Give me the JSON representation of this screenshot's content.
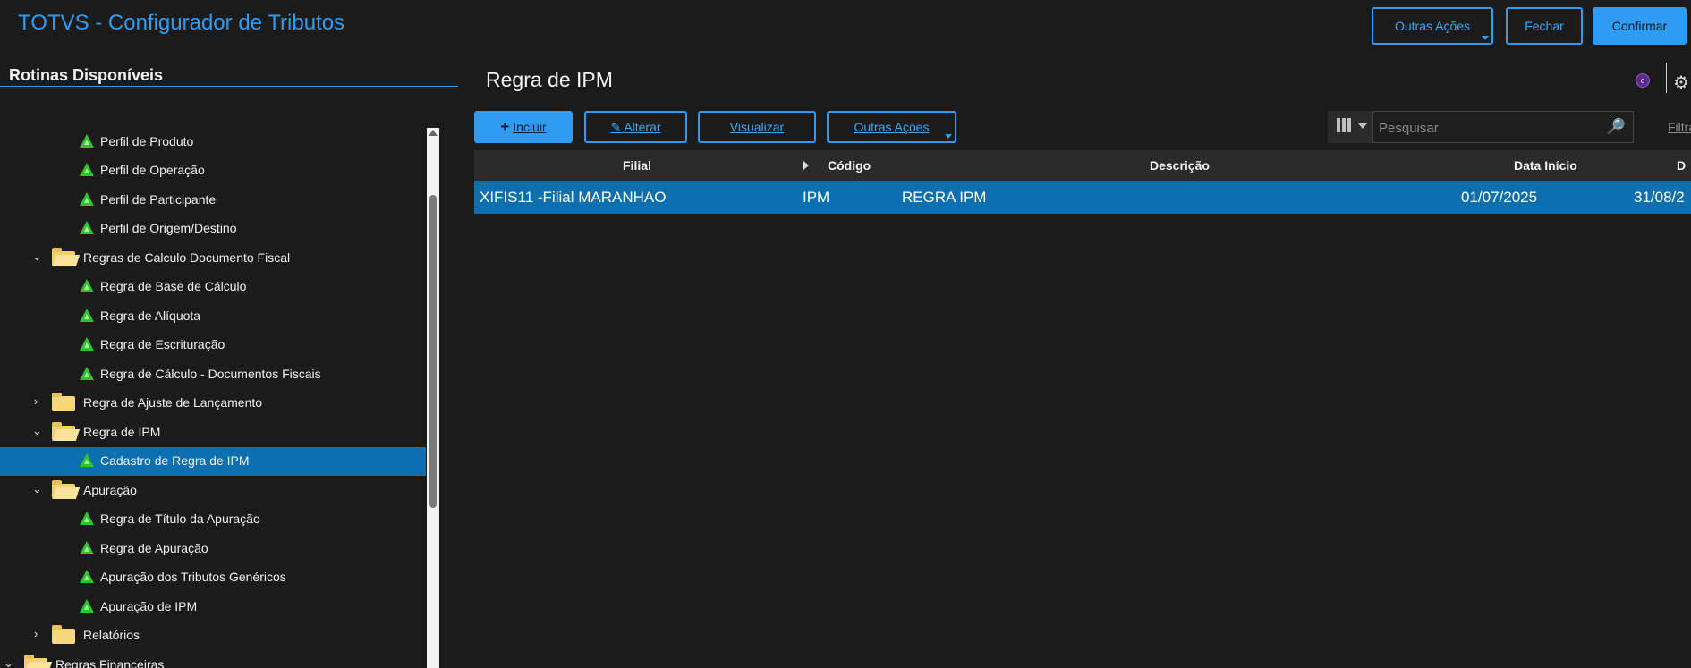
{
  "header": {
    "app_title": "TOTVS - Configurador de Tributos",
    "buttons": {
      "outras_acoes": "Outras Ações",
      "fechar": "Fechar",
      "confirmar": "Confirmar"
    }
  },
  "left_panel": {
    "title": "Rotinas Disponíveis",
    "tree": [
      {
        "label": "Perfil de Produto",
        "type": "leaf"
      },
      {
        "label": "Perfil de Operação",
        "type": "leaf"
      },
      {
        "label": "Perfil de Participante",
        "type": "leaf"
      },
      {
        "label": "Perfil de Origem/Destino",
        "type": "leaf"
      },
      {
        "label": "Regras de Calculo Documento Fiscal",
        "type": "folder-open"
      },
      {
        "label": "Regra de Base de Cálculo",
        "type": "leaf"
      },
      {
        "label": "Regra de Alíquota",
        "type": "leaf"
      },
      {
        "label": "Regra de Escrituração",
        "type": "leaf"
      },
      {
        "label": "Regra de Cálculo - Documentos Fiscais",
        "type": "leaf"
      },
      {
        "label": "Regra de Ajuste de Lançamento",
        "type": "folder-closed"
      },
      {
        "label": "Regra de IPM",
        "type": "folder-open"
      },
      {
        "label": "Cadastro de Regra de IPM",
        "type": "leaf",
        "selected": true
      },
      {
        "label": "Apuração",
        "type": "folder-open"
      },
      {
        "label": "Regra de Título da Apuração",
        "type": "leaf"
      },
      {
        "label": "Regra de Apuração",
        "type": "leaf"
      },
      {
        "label": "Apuração dos Tributos Genéricos",
        "type": "leaf"
      },
      {
        "label": "Apuração de IPM",
        "type": "leaf"
      },
      {
        "label": "Relatórios",
        "type": "folder-closed"
      },
      {
        "label": "Regras Financeiras",
        "type": "folder-open"
      }
    ]
  },
  "main": {
    "title": "Regra de IPM",
    "toolbar": {
      "incluir": "Incluir",
      "alterar": "Alterar",
      "visualizar": "Visualizar",
      "outras_acoes": "Outras Ações",
      "search_placeholder": "Pesquisar",
      "filter_link": "Filtrar"
    },
    "grid": {
      "columns": [
        "Filial",
        "Código",
        "Descrição",
        "Data Início",
        "D"
      ],
      "rows": [
        {
          "filial": "XIFIS11 -Filial MARANHAO",
          "codigo": "IPM",
          "descricao": "REGRA IPM",
          "data_inicio": "01/07/2025",
          "data_fim": "31/08/2"
        }
      ]
    }
  },
  "colors": {
    "accent": "#2e9cf2",
    "selected_row": "#0b6fb0",
    "background": "#1b1b1b",
    "leaf_icon": "#2fc42f",
    "folder_icon": "#f6d77a"
  }
}
